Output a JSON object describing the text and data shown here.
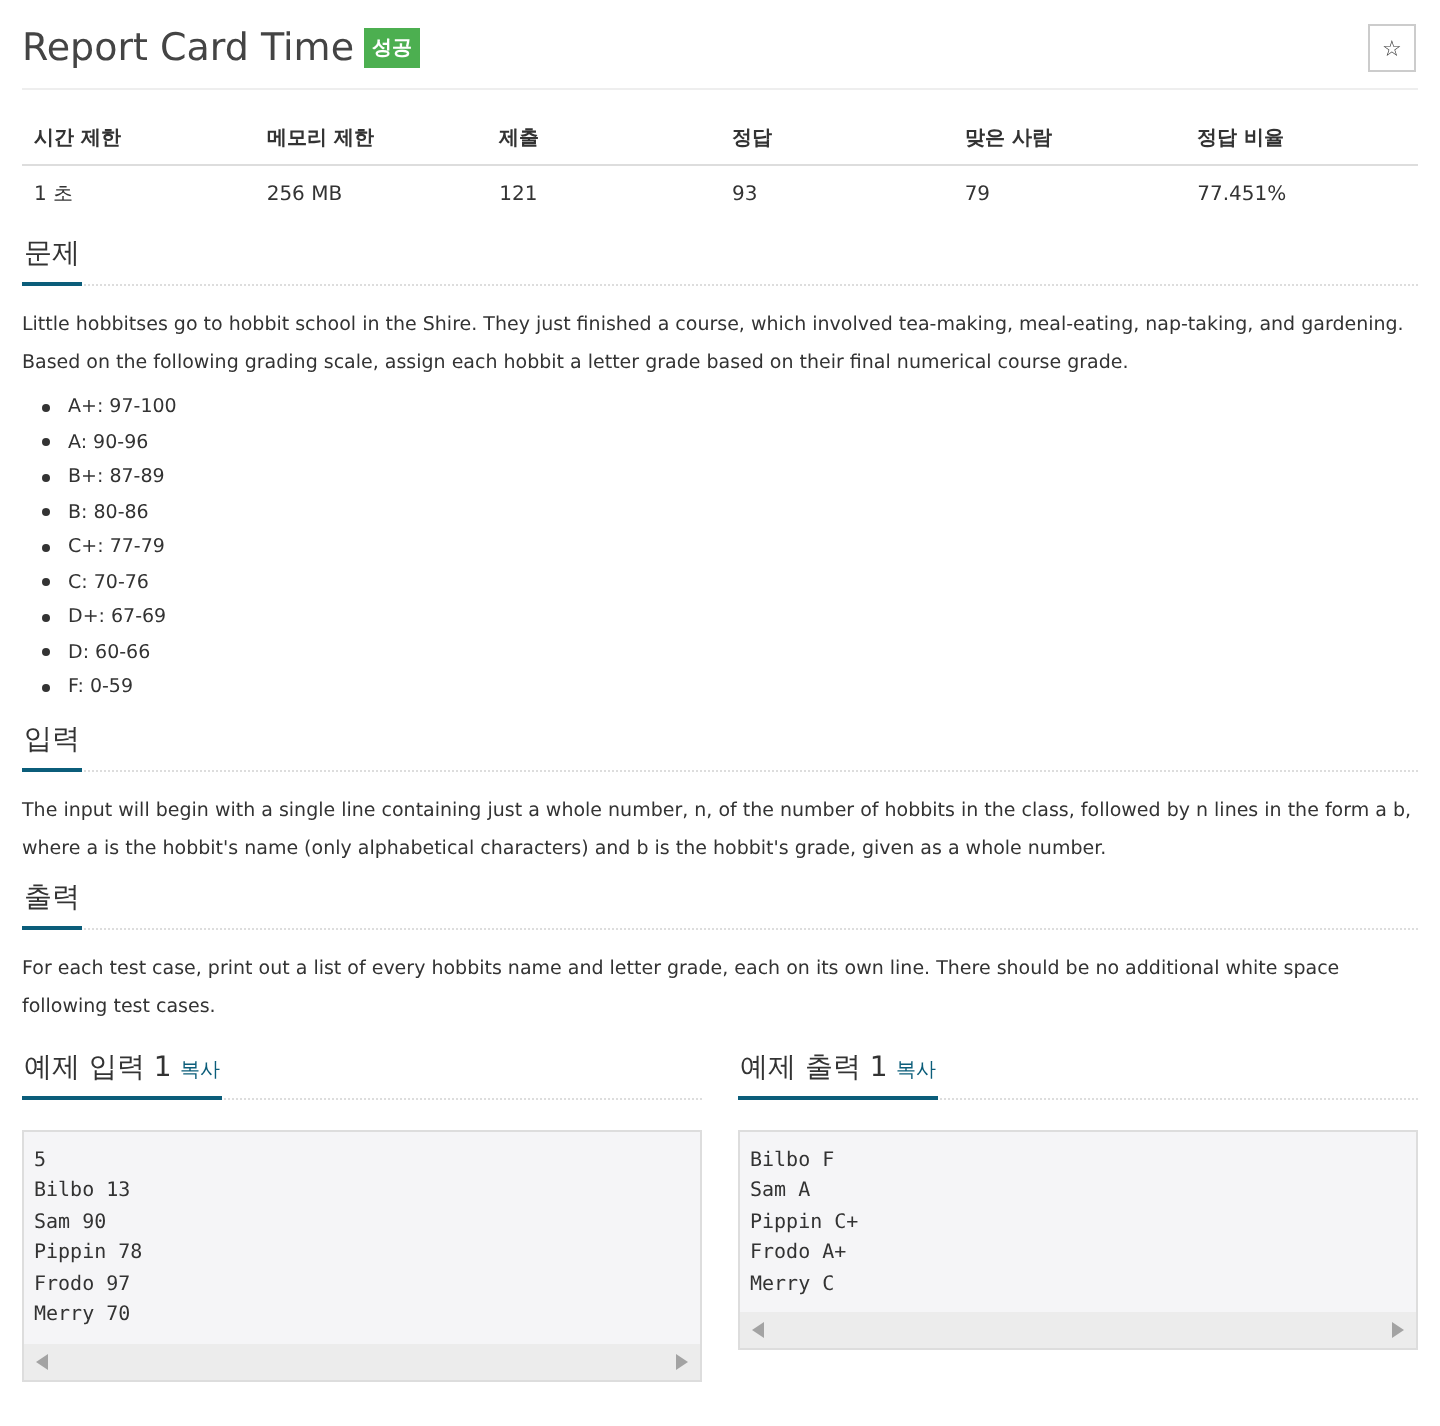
{
  "title": "Report Card Time",
  "result_badge": "성공",
  "star_button": "☆",
  "stats": {
    "columns": [
      "시간 제한",
      "메모리 제한",
      "제출",
      "정답",
      "맞은 사람",
      "정답 비율"
    ],
    "values": [
      "1 초",
      "256 MB",
      "121",
      "93",
      "79",
      "77.451%"
    ]
  },
  "problem": {
    "heading": "문제",
    "text": "Little hobbitses go to hobbit school in the Shire. They just finished a course, which involved tea-making, meal-eating, nap-taking, and gardening. Based on the following grading scale, assign each hobbit a letter grade based on their final numerical course grade.",
    "grades": [
      "A+: 97-100",
      "A: 90-96",
      "B+: 87-89",
      "B: 80-86",
      "C+: 77-79",
      "C: 70-76",
      "D+: 67-69",
      "D: 60-66",
      "F: 0-59"
    ]
  },
  "input": {
    "heading": "입력",
    "text": "The input will begin with a single line containing just a whole number, n, of the number of hobbits in the class, followed by n lines in the form a b, where a is the hobbit's name (only alphabetical characters) and b is the hobbit's grade, given as a whole number."
  },
  "output": {
    "heading": "출력",
    "text": "For each test case, print out a list of every hobbits name and letter grade, each on its own line. There should be no additional white space following test cases."
  },
  "samples": [
    {
      "heading": "예제 입력 1",
      "copy": "복사",
      "lines": [
        "5",
        "Bilbo 13",
        "Sam 90",
        "Pippin 78",
        "Frodo 97",
        "Merry 70"
      ]
    },
    {
      "heading": "예제 출력 1",
      "copy": "복사",
      "lines": [
        "Bilbo F",
        "Sam A",
        "Pippin C+",
        "Frodo A+",
        "Merry C"
      ]
    }
  ]
}
